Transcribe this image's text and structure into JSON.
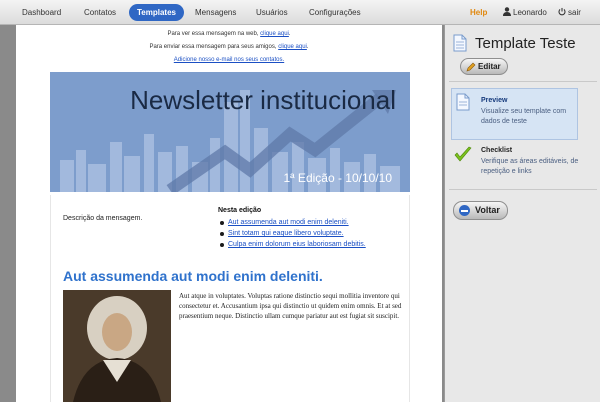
{
  "nav": {
    "items": [
      "Dashboard",
      "Contatos",
      "Templates",
      "Mensagens",
      "Usuários",
      "Configurações"
    ],
    "active": "Templates",
    "help": "Help",
    "user": "Leonardo",
    "logout": "sair"
  },
  "preheader": {
    "line1_text": "Para ver essa mensagem na web,",
    "line1_link": "clique aqui",
    "line2_text": "Para enviar essa mensagem para seus amigos,",
    "line2_link": "clique aqui",
    "line3_link": "Adicione nosso e-mail nos seus contatos."
  },
  "banner": {
    "title": "Newsletter institucional",
    "edition": "1ª Edição - 10/10/10"
  },
  "content": {
    "description": "Descrição da mensagem.",
    "toc_title": "Nesta edição",
    "toc": [
      "Aut assumenda aut modi enim deleniti.",
      "Sint totam qui eaque libero voluptate.",
      "Culpa enim dolorum eius laboriosam debitis."
    ],
    "article_title": "Aut assumenda aut modi enim deleniti.",
    "article_text": "Aut atque in voluptates. Voluptas ratione distinctio sequi mollitia inventore qui consectetur et. Accusantium ipsa qui distinctio ut quidem enim omnis. Et at sed praesentium neque. Distinctio ullam cumque pariatur aut est fugiat sit suscipit."
  },
  "panel": {
    "title": "Template Teste",
    "edit_label": "Editar",
    "preview_title": "Preview",
    "preview_desc": "Visualize seu template com dados de teste",
    "checklist_title": "Checklist",
    "checklist_desc": "Verifique as áreas editáveis, de repetição e links",
    "back_label": "Voltar"
  },
  "colors": {
    "accent": "#2f67c4",
    "help": "#e0880f",
    "banner": "#7d9dcc",
    "article_title": "#2f72cc"
  }
}
